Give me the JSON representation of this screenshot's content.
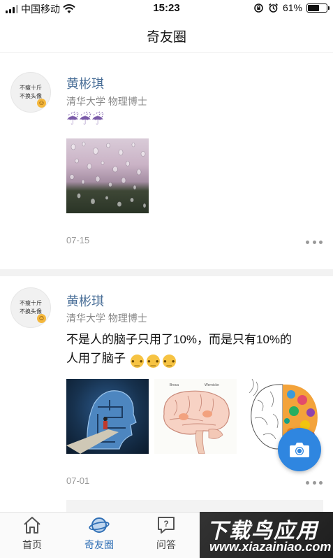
{
  "status_bar": {
    "carrier": "中国移动",
    "time": "15:23",
    "battery_percent": "61%",
    "battery_level": 0.61,
    "icons": [
      "signal-icon",
      "wifi-icon",
      "orientation-lock-icon",
      "alarm-icon",
      "battery-icon"
    ]
  },
  "nav": {
    "title": "奇友圈"
  },
  "posts": [
    {
      "avatar_text": [
        "不瘦十斤",
        "不换头像"
      ],
      "author": "黄彬琪",
      "description": "清华大学 物理博士",
      "text": "☔☔☔",
      "images": [
        "rain-window-photo"
      ],
      "date": "07-15"
    },
    {
      "avatar_text": [
        "不瘦十斤",
        "不换头像"
      ],
      "author": "黄彬琪",
      "description": "清华大学 物理博士",
      "text_line1": "不是人的脑子只用了10%，而是只有10%的",
      "text_line2": "人用了脑子",
      "images": [
        "head-maze-illustration",
        "brain-diagram",
        "brain-colorful-illustration"
      ],
      "brain_labels": [
        "Broca",
        "Wernicke"
      ],
      "date": "07-01"
    }
  ],
  "tabs": [
    {
      "label": "首页",
      "icon": "home-icon",
      "active": false
    },
    {
      "label": "奇友圈",
      "icon": "planet-icon",
      "active": true
    },
    {
      "label": "问答",
      "icon": "qa-icon",
      "active": false
    }
  ],
  "watermark": {
    "title": "下载鸟应用",
    "url": "www.xiazainiao.com"
  },
  "colors": {
    "accent": "#2f86e0",
    "author": "#4a6f98",
    "active_tab": "#2f6fb5"
  }
}
